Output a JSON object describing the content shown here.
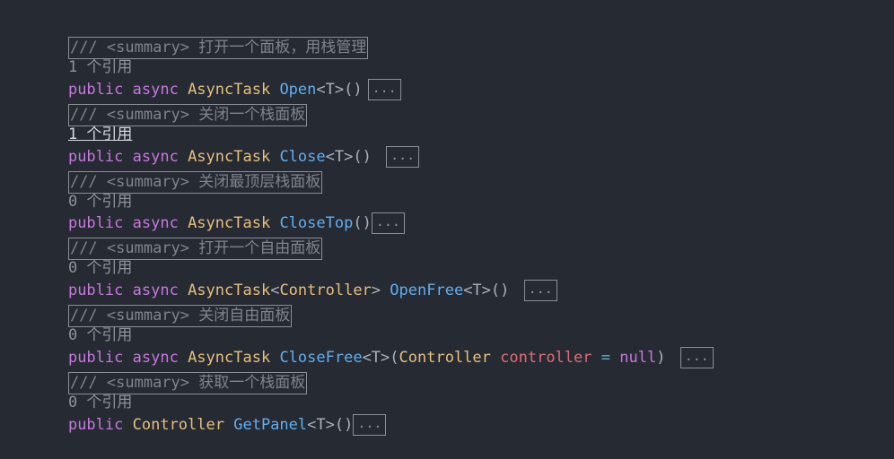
{
  "colors": {
    "background": "#262a33",
    "keyword": "#c678dd",
    "type": "#e5c07b",
    "method": "#61afef",
    "parameter": "#e06c75",
    "comment": "#7f848e"
  },
  "blocks": [
    {
      "summary": "/// <summary> 打开一个面板，用栈管理",
      "refs": "1 个引用",
      "modifier1": "public",
      "modifier2": "async",
      "return_type": "AsyncTask",
      "method": "Open",
      "generic": "<T>",
      "params": "()",
      "fold": "..."
    },
    {
      "summary": "/// <summary> 关闭一个栈面板",
      "refs": "1 个引用",
      "modifier1": "public",
      "modifier2": "async",
      "return_type": "AsyncTask",
      "method": "Close",
      "generic": "<T>",
      "params": "()",
      "fold": "..."
    },
    {
      "summary": "/// <summary> 关闭最顶层栈面板",
      "refs": "0 个引用",
      "modifier1": "public",
      "modifier2": "async",
      "return_type": "AsyncTask",
      "method": "CloseTop",
      "params": "()",
      "fold": "..."
    },
    {
      "summary": "/// <summary> 打开一个自由面板",
      "refs": "0 个引用",
      "modifier1": "public",
      "modifier2": "async",
      "return_type": "AsyncTask",
      "return_generic_open": "<",
      "return_generic_type": "Controller",
      "return_generic_close": ">",
      "method": "OpenFree",
      "generic": "<T>",
      "params": "()",
      "fold": "..."
    },
    {
      "summary": "/// <summary> 关闭自由面板",
      "refs": "0 个引用",
      "modifier1": "public",
      "modifier2": "async",
      "return_type": "AsyncTask",
      "method": "CloseFree",
      "generic": "<T>",
      "param_open": "(",
      "param_type": "Controller",
      "param_name": "controller",
      "param_eq": "=",
      "param_default": "null",
      "param_close": ")",
      "fold": "..."
    },
    {
      "summary": "/// <summary> 获取一个栈面板",
      "refs": "0 个引用",
      "modifier1": "public",
      "return_type": "Controller",
      "method": "GetPanel",
      "generic": "<T>",
      "params": "()",
      "fold": "..."
    }
  ]
}
